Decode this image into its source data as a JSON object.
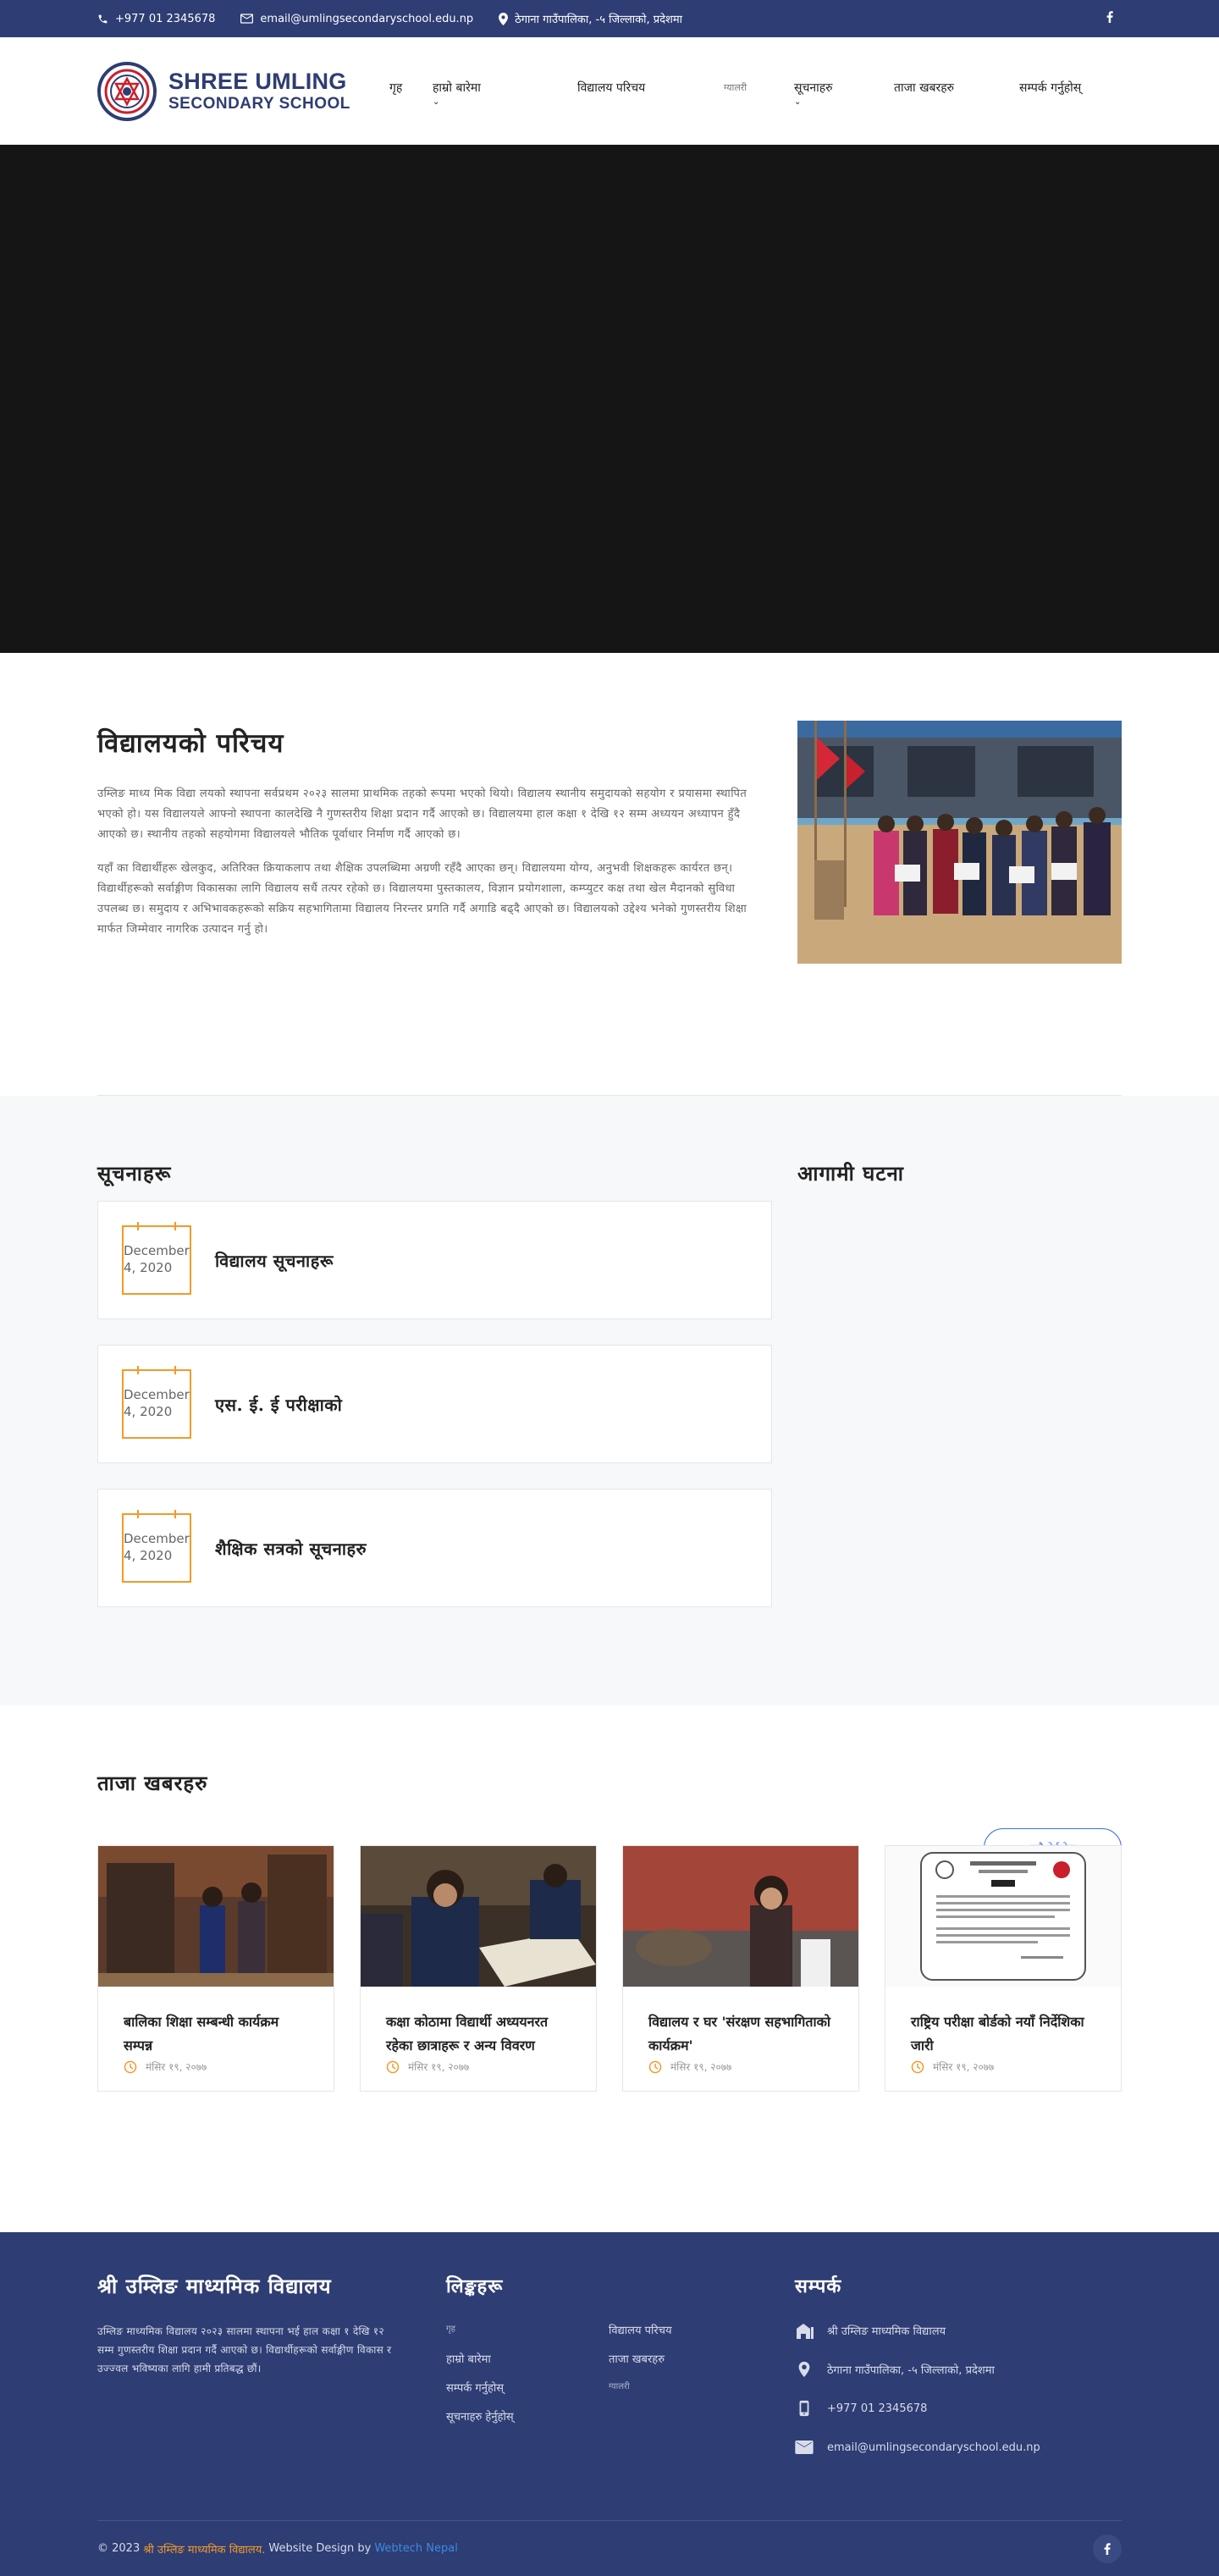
{
  "topbar": {
    "phone": "+977 01 2345678",
    "email": "email@umlingsecondaryschool.edu.np",
    "address": "ठेगाना गाउँपालिका, -५ जिल्लाको, प्रदेशमा"
  },
  "header": {
    "logo_line1": "SHREE UMLING",
    "logo_line2": "SECONDARY SCHOOL",
    "nav": [
      {
        "label": "गृह"
      },
      {
        "label": "हाम्रो बारेमा"
      },
      {
        "label": "विद्यालय परिचय"
      },
      {
        "label": "ग्यालरी"
      },
      {
        "label": "सूचनाहरु"
      },
      {
        "label": "ताजा खबरहरु"
      },
      {
        "label": "सम्पर्क गर्नुहोस्"
      }
    ]
  },
  "about": {
    "title": "विद्यालयको परिचय",
    "p1": "उम्लिङ माध्य मिक विद्या लयको स्थापना सर्वप्रथम २०२३ सालमा प्राथमिक तहको रूपमा भएको थियो। विद्यालय स्थानीय समुदायको सहयोग र प्रयासमा स्थापित भएको हो। यस विद्यालयले आफ्नो स्थापना कालदेखि नै गुणस्तरीय शिक्षा प्रदान गर्दै आएको छ। विद्यालयमा हाल कक्षा १ देखि १२ सम्म अध्ययन अध्यापन हुँदै आएको छ। स्थानीय तहको सहयोगमा विद्यालयले भौतिक पूर्वाधार निर्माण गर्दै आएको छ।",
    "p2": "यहाँ का विद्यार्थीहरू खेलकुद, अतिरिक्त क्रियाकलाप तथा शैक्षिक उपलब्धिमा अग्रणी रहँदै आएका छन्। विद्यालयमा योग्य, अनुभवी शिक्षकहरू कार्यरत छन्। विद्यार्थीहरूको सर्वाङ्गीण विकासका लागि विद्यालय सधैं तत्पर रहेको छ। विद्यालयमा पुस्तकालय, विज्ञान प्रयोगशाला, कम्प्युटर कक्ष तथा खेल मैदानको सुविधा उपलब्ध छ। समुदाय र अभिभावकहरूको सक्रिय सहभागितामा विद्यालय निरन्तर प्रगति गर्दै अगाडि बढ्दै आएको छ। विद्यालयको उद्देश्य भनेको गुणस्तरीय शिक्षा मार्फत जिम्मेवार नागरिक उत्पादन गर्नु हो।"
  },
  "notices": {
    "title": "सूचनाहरू",
    "items": [
      {
        "date": "December 4, 2020",
        "title": "विद्यालय सूचनाहरू"
      },
      {
        "date": "December 4, 2020",
        "title": "एस. ई. ई परीक्षाको"
      },
      {
        "date": "December 4, 2020",
        "title": "शैक्षिक सत्रको सूचनाहरु"
      }
    ]
  },
  "events": {
    "title": "आगामी घटना"
  },
  "news": {
    "title": "ताजा खबरहरु",
    "view_all": "सबै हेर्नुहोस्",
    "items": [
      {
        "title": "बालिका शिक्षा सम्बन्धी कार्यक्रम सम्पन्न",
        "date": "मंसिर १९, २०७७"
      },
      {
        "title": "कक्षा कोठामा विद्यार्थी अध्ययनरत रहेका छात्राहरू र अन्य विवरण",
        "date": "मंसिर १९, २०७७"
      },
      {
        "title": "विद्यालय र घर 'संरक्षण सहभागिताको कार्यक्रम'",
        "date": "मंसिर १९, २०७७"
      },
      {
        "title": "राष्ट्रिय परीक्षा बोर्डको नयाँ निर्देशिका जारी",
        "date": "मंसिर १९, २०७७"
      }
    ]
  },
  "footer": {
    "school_name": "श्री उम्लिङ माध्यमिक विद्यालय",
    "desc": "उम्लिङ माध्यमिक विद्यालय २०२३ सालमा स्थापना भई हाल कक्षा १ देखि १२ सम्म गुणस्तरीय शिक्षा प्रदान गर्दै आएको छ। विद्यार्थीहरूको सर्वाङ्गीण विकास र उज्ज्वल भविष्यका लागि हामी प्रतिबद्ध छौं।",
    "links_title": "लिङ्कहरू",
    "links": [
      {
        "label": "गृह",
        "small": true
      },
      {
        "label": "विद्यालय परिचय",
        "small": false
      },
      {
        "label": "हाम्रो बारेमा",
        "small": false
      },
      {
        "label": "ताजा खबरहरु",
        "small": false
      },
      {
        "label": "सम्पर्क गर्नुहोस्",
        "small": false
      },
      {
        "label": "ग्यालरी",
        "small": true
      },
      {
        "label": "सूचनाहरु हेर्नुहोस्",
        "small": false
      }
    ],
    "contact_title": "सम्पर्क",
    "contact": {
      "name": "श्री उम्लिङ माध्यमिक विद्यालय",
      "address": "ठेगाना गाउँपालिका, -५ जिल्लाको, प्रदेशमा",
      "phone": "+977 01 2345678",
      "email": "email@umlingsecondaryschool.edu.np"
    },
    "copyright_prefix": "© 2023",
    "copyright_name": "श्री उम्लिङ माध्यमिक विद्यालय.",
    "design_text": "Website Design by",
    "design_by": "Webtech Nepal"
  },
  "colors": {
    "brand_navy": "#2e3d73",
    "accent_orange": "#f39a2b",
    "link_blue": "#3b6fe0"
  }
}
